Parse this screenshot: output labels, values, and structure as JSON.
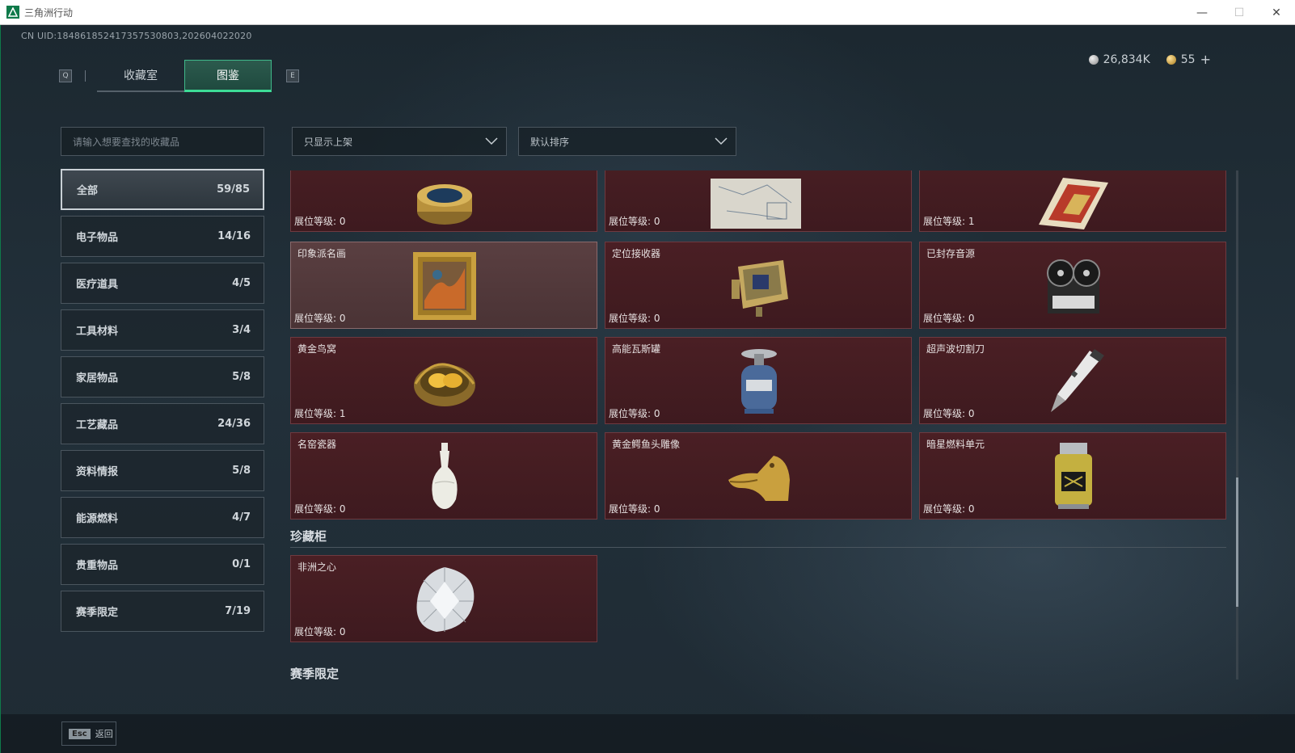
{
  "window": {
    "title": "三角洲行动",
    "controls": [
      "—",
      "☐",
      "✕"
    ]
  },
  "header": {
    "uid": "CN UID:184861852417357530803,202604022020",
    "key_left": "Q",
    "key_right": "E",
    "tabs": [
      {
        "label": "收藏室",
        "active": false
      },
      {
        "label": "图鉴",
        "active": true
      }
    ],
    "currency_silver": "26,834K",
    "currency_gold": "55",
    "plus": "+"
  },
  "sidebar": {
    "search_placeholder": "请输入想要查找的收藏品",
    "categories": [
      {
        "label": "全部",
        "count": "59/85",
        "active": true
      },
      {
        "label": "电子物品",
        "count": "14/16"
      },
      {
        "label": "医疗道具",
        "count": "4/5"
      },
      {
        "label": "工具材料",
        "count": "3/4"
      },
      {
        "label": "家居物品",
        "count": "5/8"
      },
      {
        "label": "工艺藏品",
        "count": "24/36"
      },
      {
        "label": "资料情报",
        "count": "5/8"
      },
      {
        "label": "能源燃料",
        "count": "4/7"
      },
      {
        "label": "贵重物品",
        "count": "0/1"
      },
      {
        "label": "赛季限定",
        "count": "7/19"
      }
    ]
  },
  "filters": {
    "shelf_filter": "只显示上架",
    "sort": "默认排序"
  },
  "level_label": "展位等级:",
  "items_top_row": [
    {
      "name": "",
      "level": "0",
      "icon": "caviar-tin-icon"
    },
    {
      "name": "",
      "level": "0",
      "icon": "map-document-icon"
    },
    {
      "name": "",
      "level": "1",
      "icon": "ornate-card-icon"
    }
  ],
  "items": [
    {
      "name": "印象派名画",
      "level": "0",
      "icon": "framed-painting-icon",
      "highlight": true
    },
    {
      "name": "定位接收器",
      "level": "0",
      "icon": "gps-receiver-icon"
    },
    {
      "name": "已封存音源",
      "level": "0",
      "icon": "reel-tape-recorder-icon"
    },
    {
      "name": "黄金鸟窝",
      "level": "1",
      "icon": "golden-nest-icon"
    },
    {
      "name": "高能瓦斯罐",
      "level": "0",
      "icon": "gas-canister-icon"
    },
    {
      "name": "超声波切割刀",
      "level": "0",
      "icon": "ultrasonic-knife-icon"
    },
    {
      "name": "名窑瓷器",
      "level": "0",
      "icon": "porcelain-vase-icon"
    },
    {
      "name": "黄金鳄鱼头雕像",
      "level": "0",
      "icon": "golden-crocodile-head-icon"
    },
    {
      "name": "暗星燃料单元",
      "level": "0",
      "icon": "fuel-cell-icon"
    }
  ],
  "section_cabinet": {
    "title": "珍藏柜",
    "items": [
      {
        "name": "非洲之心",
        "level": "0",
        "icon": "diamond-icon"
      }
    ]
  },
  "section_next_title": "赛季限定",
  "footer": {
    "esc_key": "Esc",
    "esc_label": "返回"
  },
  "colors": {
    "accent": "#3ddc97",
    "card_bg": "#4a1f24",
    "card_border": "#6e3a40"
  }
}
